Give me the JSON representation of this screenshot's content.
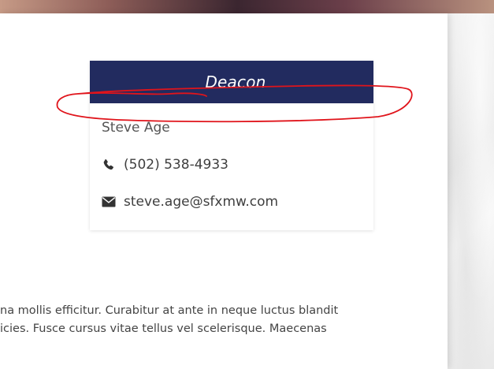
{
  "card": {
    "role": "Deacon",
    "name": "Steve Age",
    "phone": "(502) 538-4933",
    "email": "steve.age@sfxmw.com"
  },
  "body_text": {
    "line1": "na mollis efficitur. Curabitur at ante in neque luctus blandit",
    "line2": "icies. Fusce cursus vitae tellus vel scelerisque. Maecenas"
  },
  "icons": {
    "phone": "phone-icon",
    "email": "envelope-icon"
  },
  "colors": {
    "header_bg": "#222b5f",
    "annotation": "#e0141b"
  }
}
